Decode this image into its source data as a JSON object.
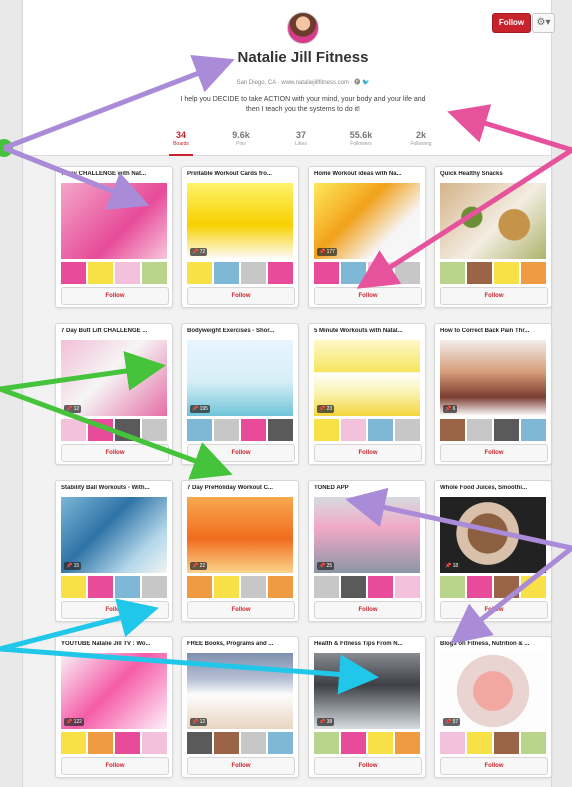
{
  "profile": {
    "name": "Natalie Jill Fitness",
    "location": "San Diego, CA · www.nataliejillfitness.com · 🅕 🐦",
    "about": "I help you DECIDE to take ACTION with your mind, your body and your life and then I teach you the systems to do it!",
    "follow_label": "Follow",
    "settings_icon": "gear-icon"
  },
  "stats": [
    {
      "value": "34",
      "label": "Boards",
      "active": true
    },
    {
      "value": "9.6k",
      "label": "Pins",
      "active": false
    },
    {
      "value": "37",
      "label": "Likes",
      "active": false
    },
    {
      "value": "55.6k",
      "label": "Followers",
      "active": false
    },
    {
      "value": "2k",
      "label": "Following",
      "active": false
    }
  ],
  "boards": [
    {
      "title": "7 Day CHALLENGE with Nat...",
      "pins": "",
      "follow": "Follow"
    },
    {
      "title": "Printable Workout Cards fro...",
      "pins": "72",
      "follow": "Follow"
    },
    {
      "title": "Home Workout ideas with Na...",
      "pins": "177",
      "follow": "Follow"
    },
    {
      "title": "Quick Healthy Snacks",
      "pins": "",
      "follow": "Follow"
    },
    {
      "title": "7 Day Butt Lift CHALLENGE ...",
      "pins": "12",
      "follow": "Follow"
    },
    {
      "title": "Bodyweight Exercises - Shor...",
      "pins": "195",
      "follow": "Follow"
    },
    {
      "title": "5 Minute Workouts with Natal...",
      "pins": "23",
      "follow": "Follow"
    },
    {
      "title": "How to Correct Back Pain Thr...",
      "pins": "6",
      "follow": "Follow"
    },
    {
      "title": "Stability Ball Workouts - With...",
      "pins": "15",
      "follow": "Follow"
    },
    {
      "title": "7 Day PreHoliday Workout C...",
      "pins": "22",
      "follow": "Follow"
    },
    {
      "title": "TONED APP",
      "pins": "25",
      "follow": "Follow"
    },
    {
      "title": "Whole Food Juices, Smoothi...",
      "pins": "18",
      "follow": "Follow"
    },
    {
      "title": "YOUTUBE Natalie Jill TV : Wo...",
      "pins": "122",
      "follow": "Follow"
    },
    {
      "title": "FREE Books, Programs and ...",
      "pins": "12",
      "follow": "Follow"
    },
    {
      "title": "Health & Fitness Tips From N...",
      "pins": "38",
      "follow": "Follow"
    },
    {
      "title": "Blogs on Fitness, Nutrition & ...",
      "pins": "57",
      "follow": "Follow"
    }
  ],
  "colors": {
    "accent": "#c8232c",
    "annotation_purple": "#a98bd8",
    "annotation_pink": "#e7529d",
    "annotation_green": "#45c33a",
    "annotation_cyan": "#20c7e9"
  }
}
